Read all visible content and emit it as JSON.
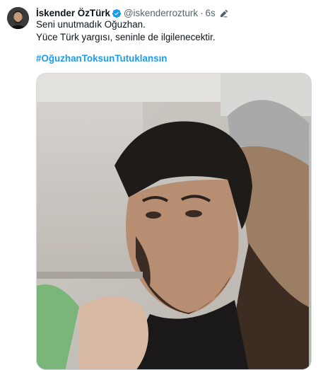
{
  "tweet": {
    "author_name": "İskender ÖzTürk",
    "handle": "@iskenderrozturk",
    "separator": "·",
    "time": "6s",
    "text_line_1": "Seni unutmadık Oğuzhan.",
    "text_line_2": "Yüce Türk yargısı, seninle de ilgilenecektir.",
    "hashtag": "#OğuzhanToksunTutuklansın"
  },
  "icons": {
    "verified": "verified-badge-icon",
    "edit": "edit-pencil-icon"
  },
  "colors": {
    "text": "#0f1419",
    "secondary": "#536471",
    "link": "#1d9bf0",
    "verified": "#1d9bf0"
  }
}
